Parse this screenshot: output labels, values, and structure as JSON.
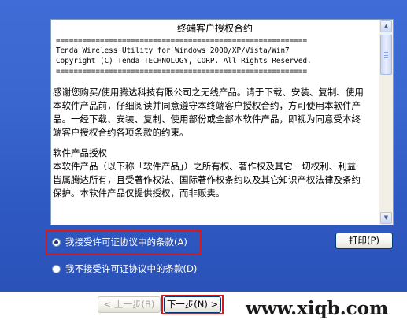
{
  "license": {
    "title": "终端客户授权合约",
    "separator": "=========================================================",
    "header_line_1": "Tenda Wireless Utility for Windows 2000/XP/Vista/Win7",
    "header_line_2": "Copyright (C) Tenda TECHNOLOGY, CORP. All Rights Reserved.",
    "paragraph_1_lines": [
      "感谢您购买/使用腾达科技有限公司之无线产品。请于下载、安装、复制、使用",
      "本软件产品前，仔细阅读并同意遵守本终端客户授权合约，方可使用本软件产",
      "品。一经下载、安装、复制、使用部份或全部本软件产品，即视为同意受本终",
      "端客户授权合约各项条款的约束。"
    ],
    "paragraph_2_lines": [
      "软件产品授权",
      "本软件产品（以下称「软件产品」）之所有权、著作权及其它一切权利、利益",
      "皆属腾达所有，且受著作权法、国际著作权条约以及其它知识产权法律及条约",
      "保护。本软件产品仅提供授权，而非贩卖。"
    ]
  },
  "options": {
    "accept_label": "我接受许可证协议中的条款(A)",
    "decline_label": "我不接受许可证协议中的条款(D)",
    "selected": "accept"
  },
  "buttons": {
    "print_label": "打印(P)",
    "back_label": "< 上一步(B)",
    "next_label": "下一步(N) >"
  },
  "watermark": "www.xiqb.com",
  "colors": {
    "panel_blue": "#3a66cf",
    "highlight_red": "#d7191c"
  }
}
